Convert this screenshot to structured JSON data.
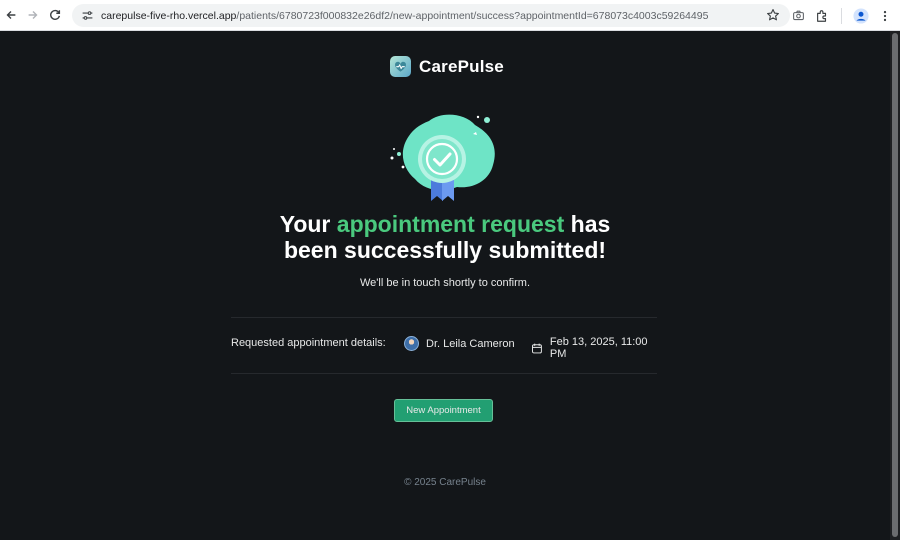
{
  "browser": {
    "url_host": "carepulse-five-rho.vercel.app",
    "url_path": "/patients/6780723f000832e26df2/new-appointment/success?appointmentId=678073c4003c59264495",
    "icons": [
      "back-arrow-icon",
      "forward-arrow-icon",
      "reload-icon",
      "site-settings-icon",
      "bookmark-star-icon",
      "screenshot-icon",
      "extensions-icon",
      "profile-icon",
      "menu-dots-icon"
    ]
  },
  "brand": {
    "name": "CarePulse",
    "icon": "carepulse-logo-icon"
  },
  "success": {
    "icon": "success-badge-icon",
    "headline_pre": "Your ",
    "headline_accent": "appointment request",
    "headline_post": " has",
    "headline_line2": "been successfully submitted!",
    "subtitle": "We'll be in touch shortly to confirm."
  },
  "details": {
    "label": "Requested appointment details:",
    "doctor_name": "Dr. Leila Cameron",
    "appointment_date": "Feb 13, 2025, 11:00 PM"
  },
  "actions": {
    "new_appointment_label": "New Appointment"
  },
  "footer": {
    "copyright": "© 2025 CarePulse"
  },
  "colors": {
    "background": "#131619",
    "accent_green": "#4ac97e",
    "button_green": "#24ae7c"
  }
}
